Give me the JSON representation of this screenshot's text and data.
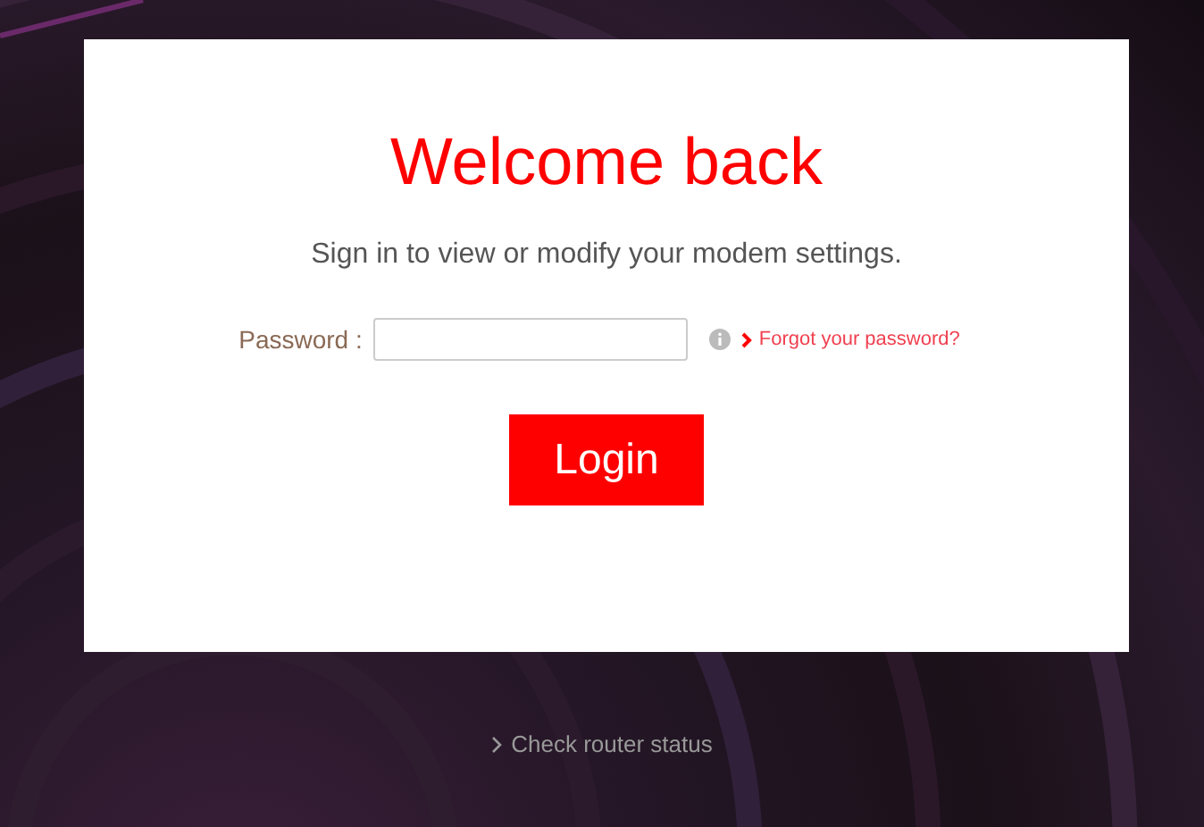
{
  "title": "Welcome back",
  "subtitle": "Sign in to view or modify your modem settings.",
  "password": {
    "label": "Password :"
  },
  "forgot_link": "Forgot your password?",
  "login_button": "Login",
  "footer_link": "Check router status"
}
